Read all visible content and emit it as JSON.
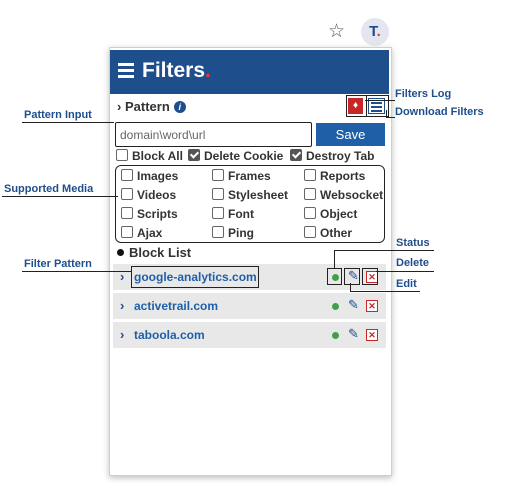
{
  "browser": {
    "star_icon": "star-icon",
    "extension_icon_text": "T",
    "extension_icon_dot": "."
  },
  "header": {
    "title": "Filters",
    "title_dot": "."
  },
  "pattern": {
    "label": "Pattern",
    "placeholder": "domain\\word\\url",
    "save_label": "Save"
  },
  "actions": {
    "block_all": "Block All",
    "delete_cookie": "Delete Cookie",
    "destroy_tab": "Destroy Tab"
  },
  "media": {
    "images": "Images",
    "frames": "Frames",
    "reports": "Reports",
    "videos": "Videos",
    "stylesheet": "Stylesheet",
    "websocket": "Websocket",
    "scripts": "Scripts",
    "font": "Font",
    "object": "Object",
    "ajax": "Ajax",
    "ping": "Ping",
    "other": "Other"
  },
  "block_list": {
    "title": "Block List",
    "items": [
      {
        "domain": "google-analytics.com"
      },
      {
        "domain": "activetrail.com"
      },
      {
        "domain": "taboola.com"
      }
    ]
  },
  "callouts": {
    "filters_log": "Filters Log",
    "download_filters": "Download Filters",
    "pattern_input": "Pattern Input",
    "supported_media": "Supported Media",
    "filter_pattern": "Filter Pattern",
    "status": "Status",
    "delete": "Delete",
    "edit": "Edit"
  },
  "colors": {
    "header": "#1f4e8c",
    "accent": "#1f5fa8",
    "status_on": "#43a047",
    "delete": "#c62828"
  }
}
